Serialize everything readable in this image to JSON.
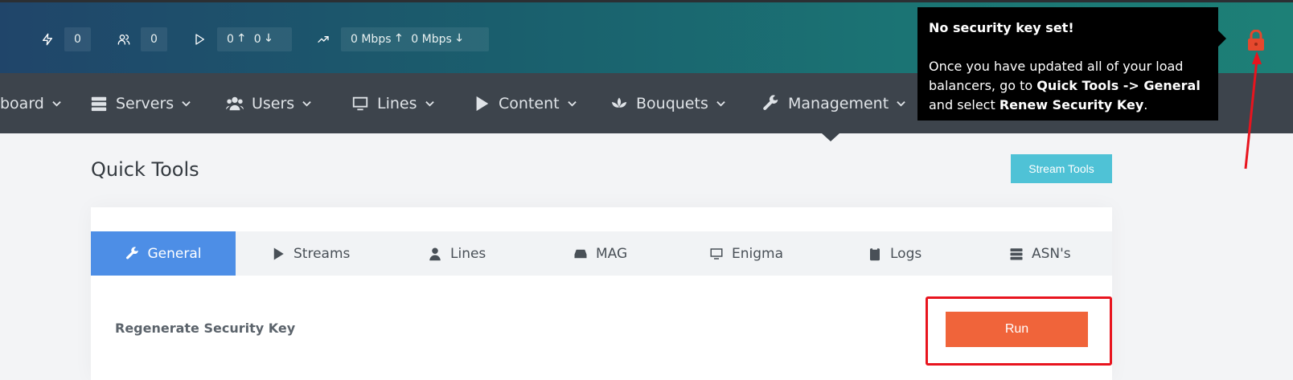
{
  "stats": {
    "connections": "0",
    "users": "0",
    "streams_up": "0",
    "streams_down": "0",
    "bandwidth_in": "0 Mbps",
    "bandwidth_out": "0 Mbps"
  },
  "nav": {
    "items": [
      {
        "label": "board",
        "icon": "dashboard-icon"
      },
      {
        "label": "Servers",
        "icon": "server-icon"
      },
      {
        "label": "Users",
        "icon": "users-icon"
      },
      {
        "label": "Lines",
        "icon": "monitor-icon"
      },
      {
        "label": "Content",
        "icon": "play-icon"
      },
      {
        "label": "Bouquets",
        "icon": "lotus-icon"
      },
      {
        "label": "Management",
        "icon": "wrench-icon"
      }
    ]
  },
  "tooltip": {
    "title": "No security key set!",
    "body_1": "Once you have updated all of your load balancers, go to ",
    "body_bold_1": "Quick Tools -> General",
    "body_2": " and select ",
    "body_bold_2": "Renew Security Key",
    "body_3": "."
  },
  "page": {
    "title": "Quick Tools",
    "stream_tools_label": "Stream Tools"
  },
  "tabs": [
    {
      "label": "General",
      "icon": "wrench-icon",
      "active": true
    },
    {
      "label": "Streams",
      "icon": "play-icon"
    },
    {
      "label": "Lines",
      "icon": "user-icon"
    },
    {
      "label": "MAG",
      "icon": "hdd-icon"
    },
    {
      "label": "Enigma",
      "icon": "monitor-icon"
    },
    {
      "label": "Logs",
      "icon": "clipboard-icon"
    },
    {
      "label": "ASN's",
      "icon": "server-icon"
    }
  ],
  "tool_row": {
    "label": "Regenerate Security Key",
    "button_label": "Run"
  },
  "colors": {
    "accent_tab": "#4d8ee6",
    "run_button": "#f0643a",
    "stream_tools": "#4fc2d6",
    "lock": "#e5482d",
    "annotation": "#e8141e"
  }
}
